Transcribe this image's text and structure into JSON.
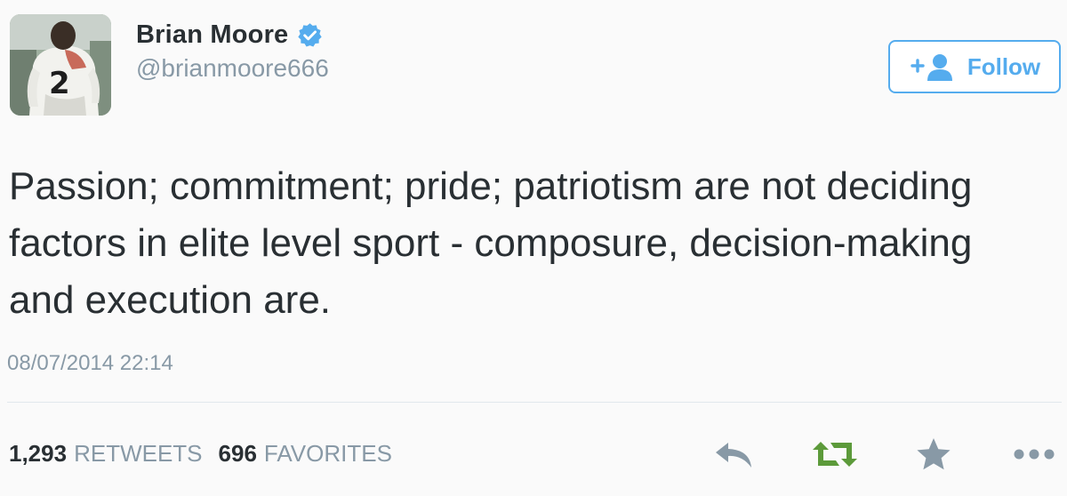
{
  "user": {
    "display_name": "Brian Moore",
    "handle": "@brianmoore666",
    "verified": true,
    "avatar_jersey_number": "2"
  },
  "follow_button": {
    "label": "Follow",
    "icon": "add-user-icon"
  },
  "tweet": {
    "text": "Passion; commitment; pride; patriotism are not deciding factors in elite level sport - composure, decision-making and execution are.",
    "timestamp": "08/07/2014 22:14"
  },
  "stats": {
    "retweets_count": "1,293",
    "retweets_label": "RETWEETS",
    "favorites_count": "696",
    "favorites_label": "FAVORITES"
  },
  "actions": [
    "reply-icon",
    "retweet-icon",
    "favorite-icon",
    "more-icon"
  ],
  "colors": {
    "accent": "#55acee",
    "retweet_green": "#5c9a3a",
    "muted": "#8899a6",
    "icon_gray": "#8899a6",
    "text": "#292f33"
  }
}
